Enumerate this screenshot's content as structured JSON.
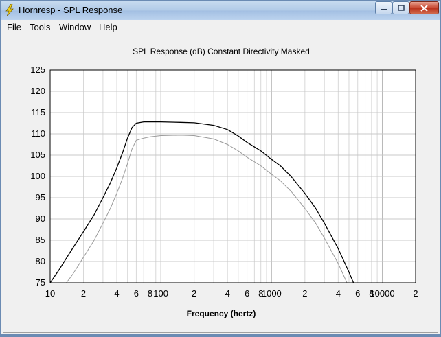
{
  "window": {
    "title": "Hornresp - SPL Response",
    "buttons": {
      "minimize": "minimize",
      "maximize": "maximize",
      "close": "close"
    }
  },
  "menu": {
    "items": [
      {
        "label": "File"
      },
      {
        "label": "Tools"
      },
      {
        "label": "Window"
      },
      {
        "label": "Help"
      }
    ]
  },
  "chart_data": {
    "type": "line",
    "title": "SPL Response (dB)   Constant Directivity   Masked",
    "xlabel": "Frequency (hertz)",
    "ylabel": "",
    "xscale": "log",
    "xlim": [
      10,
      20000
    ],
    "ylim": [
      75,
      125
    ],
    "yticks": [
      75,
      80,
      85,
      90,
      95,
      100,
      105,
      110,
      115,
      120,
      125
    ],
    "xtick_labels": [
      {
        "x": 10,
        "label": "10"
      },
      {
        "x": 20,
        "label": "2"
      },
      {
        "x": 40,
        "label": "4"
      },
      {
        "x": 60,
        "label": "6"
      },
      {
        "x": 80,
        "label": "8"
      },
      {
        "x": 100,
        "label": "100"
      },
      {
        "x": 200,
        "label": "2"
      },
      {
        "x": 400,
        "label": "4"
      },
      {
        "x": 600,
        "label": "6"
      },
      {
        "x": 800,
        "label": "8"
      },
      {
        "x": 1000,
        "label": "1000"
      },
      {
        "x": 2000,
        "label": "2"
      },
      {
        "x": 4000,
        "label": "4"
      },
      {
        "x": 6000,
        "label": "6"
      },
      {
        "x": 8000,
        "label": "8"
      },
      {
        "x": 10000,
        "label": "10000"
      },
      {
        "x": 20000,
        "label": "2"
      }
    ],
    "grid": true,
    "legend": "none",
    "series": [
      {
        "color": "#000000",
        "points": [
          [
            10,
            75
          ],
          [
            12,
            78
          ],
          [
            15,
            82
          ],
          [
            20,
            87
          ],
          [
            25,
            91
          ],
          [
            30,
            95
          ],
          [
            35,
            98.5
          ],
          [
            40,
            102
          ],
          [
            45,
            105.5
          ],
          [
            50,
            109
          ],
          [
            55,
            111.5
          ],
          [
            60,
            112.5
          ],
          [
            70,
            112.8
          ],
          [
            80,
            112.8
          ],
          [
            100,
            112.8
          ],
          [
            150,
            112.7
          ],
          [
            200,
            112.6
          ],
          [
            300,
            112
          ],
          [
            400,
            111
          ],
          [
            500,
            109.5
          ],
          [
            600,
            108
          ],
          [
            800,
            106
          ],
          [
            1000,
            104
          ],
          [
            1200,
            102.5
          ],
          [
            1500,
            100
          ],
          [
            2000,
            96
          ],
          [
            2500,
            92.5
          ],
          [
            3000,
            89
          ],
          [
            4000,
            83
          ],
          [
            5000,
            77.5
          ],
          [
            5500,
            75
          ]
        ]
      },
      {
        "color": "#9a9a9a",
        "points": [
          [
            14,
            75
          ],
          [
            16,
            77
          ],
          [
            20,
            81
          ],
          [
            25,
            85
          ],
          [
            30,
            89
          ],
          [
            35,
            92.5
          ],
          [
            40,
            96
          ],
          [
            45,
            99.5
          ],
          [
            50,
            103
          ],
          [
            55,
            106.5
          ],
          [
            60,
            108.5
          ],
          [
            70,
            109
          ],
          [
            80,
            109.3
          ],
          [
            100,
            109.6
          ],
          [
            150,
            109.7
          ],
          [
            200,
            109.6
          ],
          [
            300,
            108.8
          ],
          [
            400,
            107.5
          ],
          [
            500,
            106
          ],
          [
            600,
            104.5
          ],
          [
            800,
            102.5
          ],
          [
            1000,
            100.5
          ],
          [
            1200,
            99
          ],
          [
            1500,
            96.5
          ],
          [
            2000,
            92.5
          ],
          [
            2500,
            89
          ],
          [
            3000,
            85.5
          ],
          [
            4000,
            79.5
          ],
          [
            4800,
            75
          ]
        ]
      }
    ]
  }
}
